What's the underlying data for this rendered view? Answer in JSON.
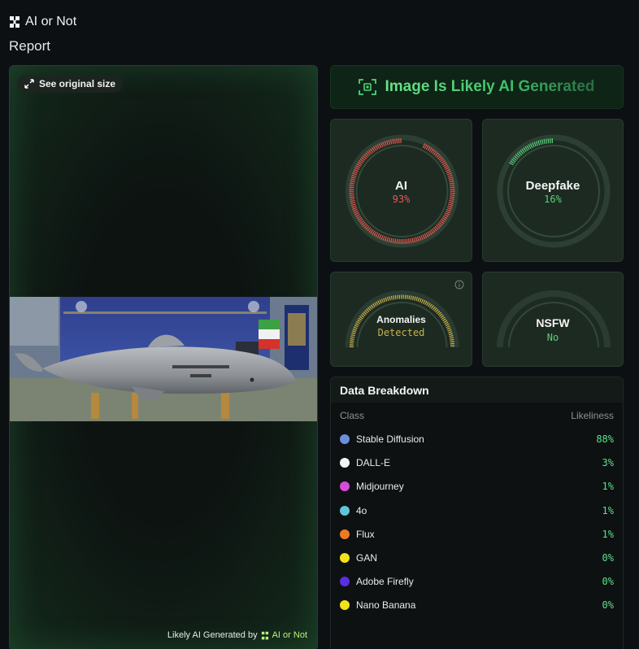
{
  "brand": {
    "name": "AI or Not"
  },
  "report_title": "Report",
  "image_panel": {
    "see_original_label": "See original size",
    "watermark_prefix": "Likely AI Generated by",
    "watermark_brand": "AI or Not"
  },
  "verdict": {
    "text": "Image Is Likely AI Generated"
  },
  "gauges": {
    "ai": {
      "label": "AI",
      "value": "93%",
      "fraction": 0.93,
      "color": "#e35a52"
    },
    "deepfake": {
      "label": "Deepfake",
      "value": "16%",
      "fraction": 0.16,
      "color": "#5ccf7c"
    },
    "anomalies": {
      "label": "Anomalies",
      "value": "Detected",
      "color": "#c9b24a"
    },
    "nsfw": {
      "label": "NSFW",
      "value": "No",
      "color": "#5ccf7c"
    }
  },
  "breakdown": {
    "title": "Data Breakdown",
    "col_class": "Class",
    "col_likeliness": "Likeliness",
    "rows": [
      {
        "name": "Stable Diffusion",
        "value": "88%",
        "color": "#6c8fdc"
      },
      {
        "name": "DALL-E",
        "value": "3%",
        "color": "#f4f4f4"
      },
      {
        "name": "Midjourney",
        "value": "1%",
        "color": "#d54cdc"
      },
      {
        "name": "4o",
        "value": "1%",
        "color": "#5fc6d8"
      },
      {
        "name": "Flux",
        "value": "1%",
        "color": "#ef7a24"
      },
      {
        "name": "GAN",
        "value": "0%",
        "color": "#f3e31a"
      },
      {
        "name": "Adobe Firefly",
        "value": "0%",
        "color": "#5b2ee0"
      },
      {
        "name": "Nano Banana",
        "value": "0%",
        "color": "#f3e31a"
      }
    ]
  }
}
